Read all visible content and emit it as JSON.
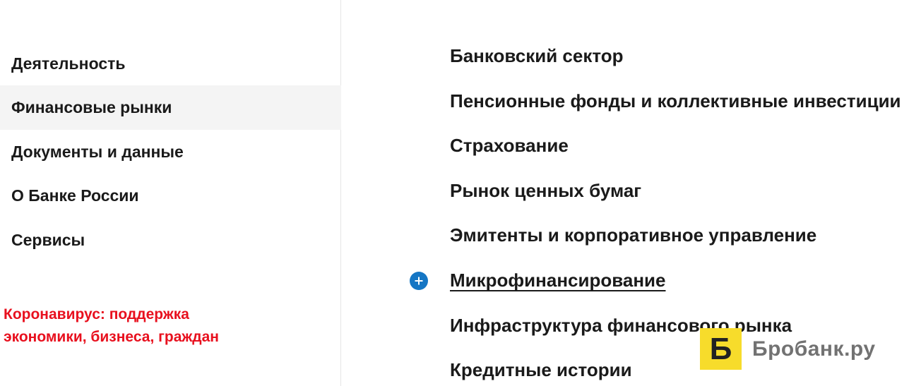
{
  "sidebar": {
    "items": [
      {
        "label": "Деятельность"
      },
      {
        "label": "Финансовые рынки",
        "active": true
      },
      {
        "label": "Документы и данные"
      },
      {
        "label": "О Банке России"
      },
      {
        "label": "Сервисы"
      }
    ],
    "promo_line1": "Коронавирус: поддержка",
    "promo_line2": "экономики, бизнеса, граждан",
    "promo_color": "#e8101e"
  },
  "submenu": {
    "items": [
      {
        "label": "Банковский сектор"
      },
      {
        "label": "Пенсионные фонды и коллективные инвестиции"
      },
      {
        "label": "Страхование"
      },
      {
        "label": "Рынок ценных бумаг"
      },
      {
        "label": "Эмитенты и корпоративное управление"
      },
      {
        "label": "Микрофинансирование",
        "hovered": true,
        "icon": "plus-icon"
      },
      {
        "label": "Инфраструктура финансового рынка"
      },
      {
        "label": "Кредитные истории"
      }
    ]
  },
  "watermark": {
    "logo_letter": "Б",
    "text": "Бробанк.ру"
  },
  "colors": {
    "accent_blue": "#1576c4",
    "active_bg": "#f4f4f4",
    "watermark_yellow": "#f7dc2b"
  }
}
